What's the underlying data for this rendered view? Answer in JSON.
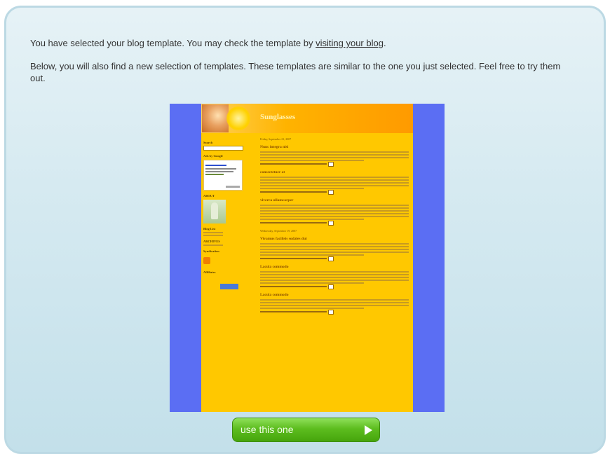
{
  "message": {
    "line1_before": "You have selected your blog template. You may check the template by ",
    "line1_link": "visiting your blog",
    "line1_after": ".",
    "line2": "Below, you will also find a new selection of templates. These templates are similar to the one you just selected. Feel free to try them out."
  },
  "preview": {
    "blog_title": "Sunglasses",
    "sidebar": {
      "search_heading": "Search",
      "ads_heading": "Ads by Google",
      "ad_link": "Cheap Vacation Ads",
      "about_heading": "ABOUT",
      "blog_list_heading": "Blog List",
      "archive_heading": "ARCHIVES",
      "syndication_heading": "Syndication",
      "affiliate_heading": "Affiliates"
    },
    "main": {
      "date1": "Friday, September 21, 2007",
      "post1_title": "Nunc integra nisi",
      "post2_title": "consectetuer at",
      "post3_title": "viverra ullamcorper",
      "date2": "Wednesday, September 19, 2007",
      "post4_title": "Vivamus facilisis sodales dui",
      "post5_title": "Lacula commodo",
      "post6_title": "Lacula commodo"
    }
  },
  "actions": {
    "use_button_label": "use this one"
  },
  "colors": {
    "preview_side": "#5b6ef3",
    "blog_bg": "#ffc800",
    "button_green": "#5dbd1f"
  },
  "icons": {
    "use_button_arrow": "play-arrow-icon"
  }
}
